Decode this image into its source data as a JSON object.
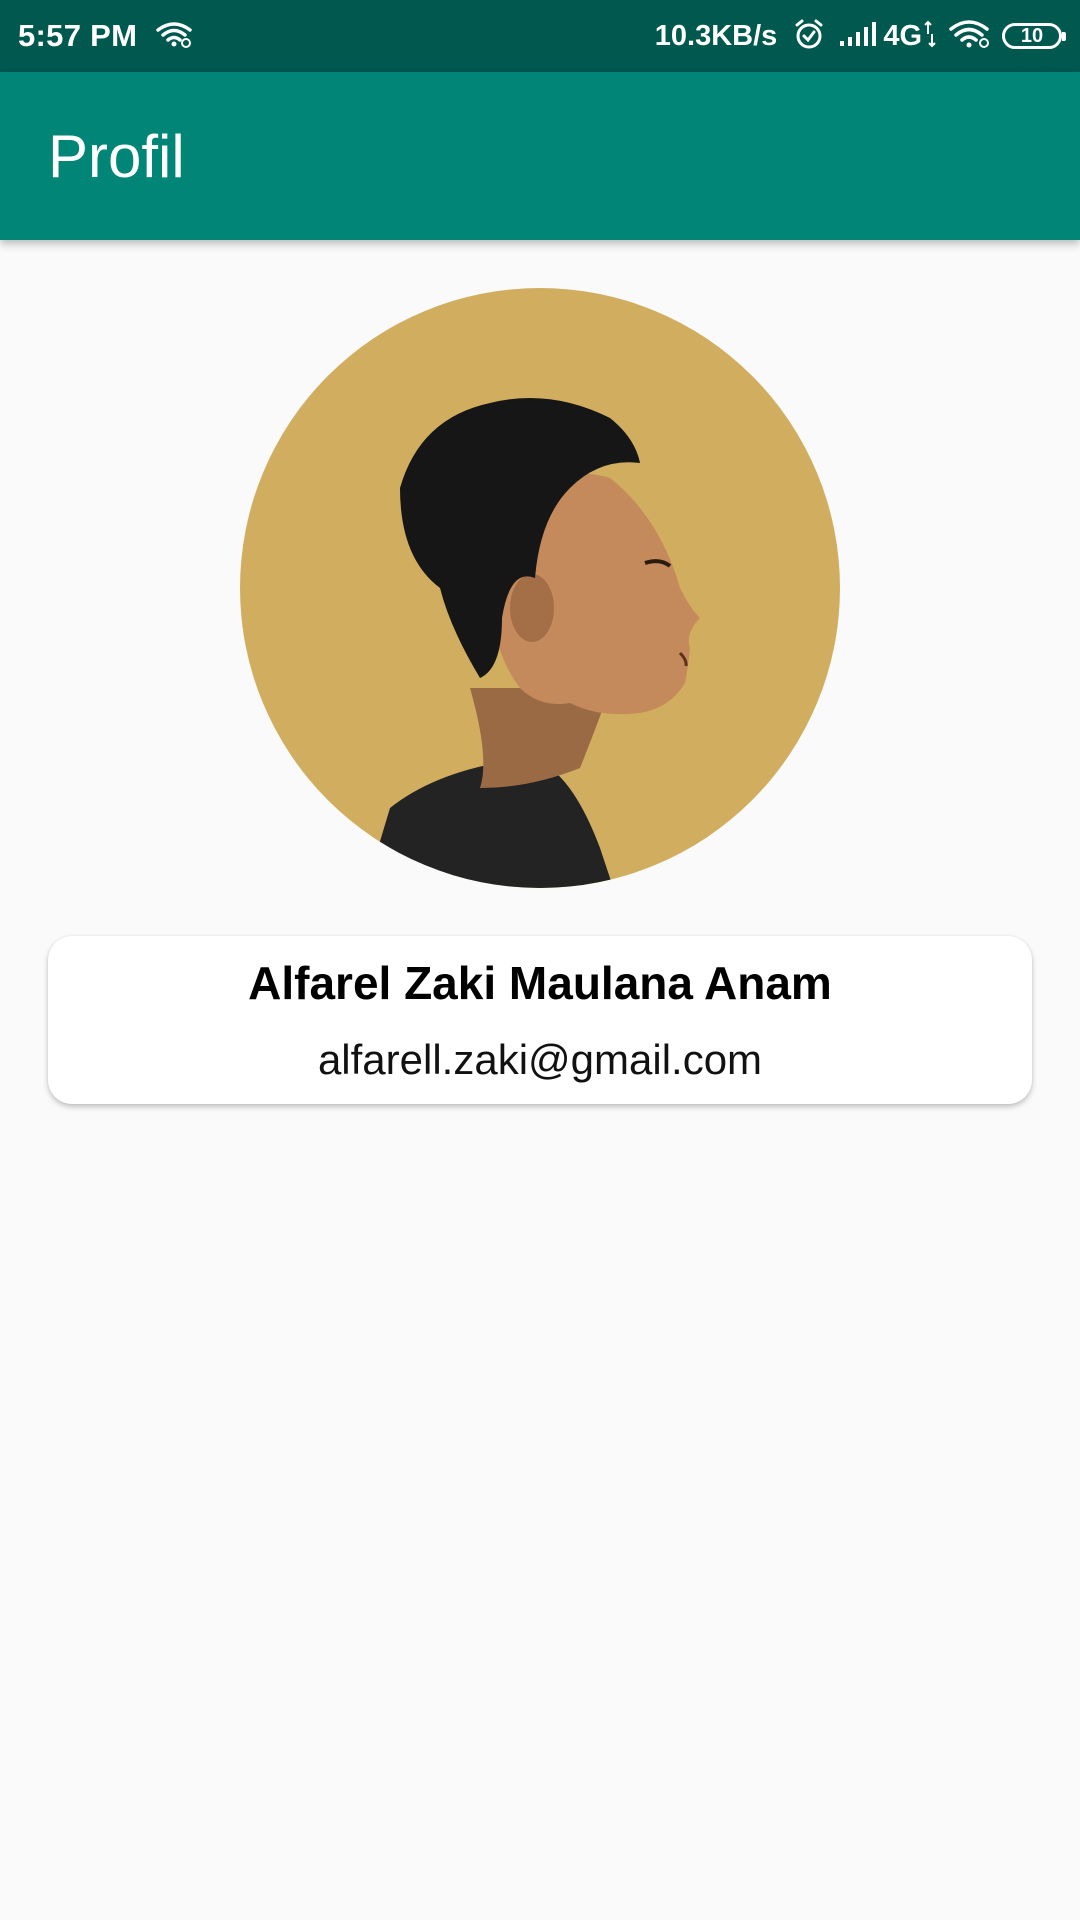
{
  "status_bar": {
    "time": "5:57 PM",
    "speed": "10.3KB/s",
    "network": "4G",
    "battery_level": "10",
    "icons": [
      "wifi-icon",
      "alarm-icon",
      "signal-icon",
      "wifi-icon",
      "battery-icon"
    ]
  },
  "app_bar": {
    "title": "Profil"
  },
  "profile": {
    "name": "Alfarel Zaki Maulana Anam",
    "email": "alfarell.zaki@gmail.com",
    "avatar_background": "#d1ae5f"
  },
  "colors": {
    "status_bar": "#00584f",
    "app_bar": "#008577",
    "background": "#fafafa",
    "card": "#ffffff"
  }
}
